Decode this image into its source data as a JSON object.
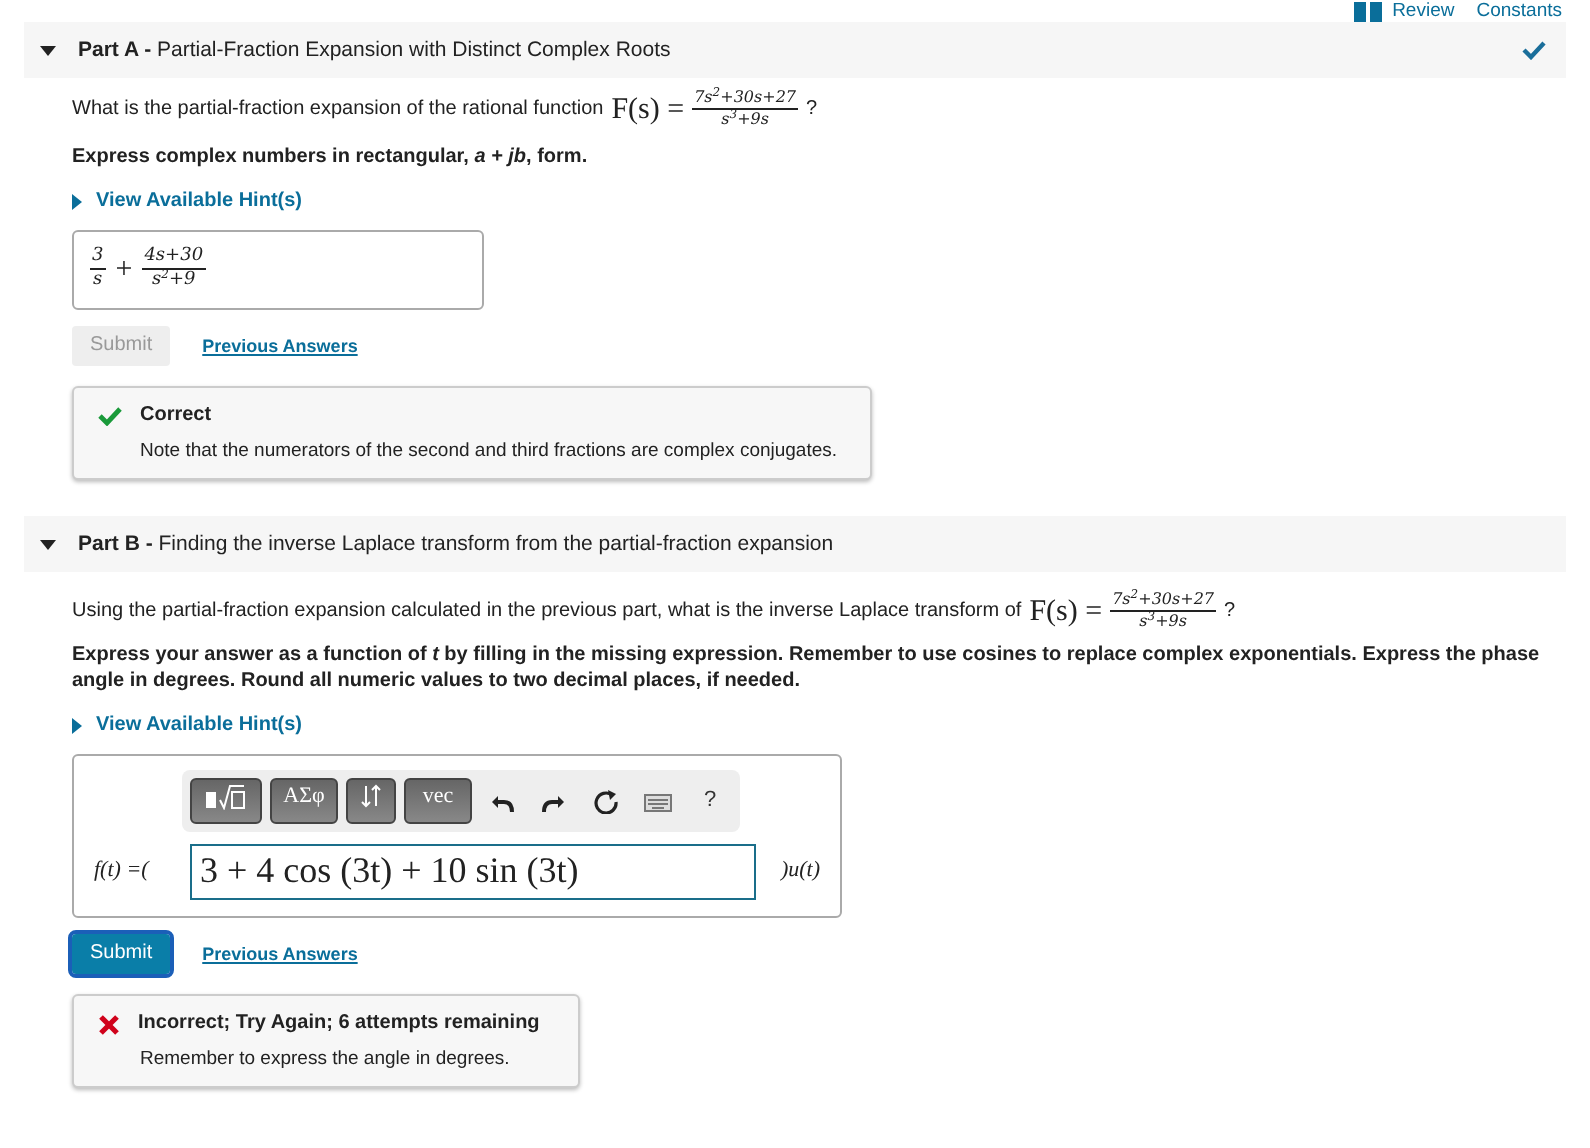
{
  "top_links": [
    {
      "label": "Review"
    },
    {
      "label": "Constants"
    }
  ],
  "parts": [
    {
      "label": "Part A -",
      "title": "Partial-Fraction Expansion with Distinct Complex Roots",
      "expanded": true,
      "completed": true,
      "question": {
        "text": "What is the partial-fraction expansion of the rational function",
        "lhs": "F(s) =",
        "numerator": "7s$^{2}$+30s+27",
        "denominator": "s$^{3}$+9s",
        "suffix": "?"
      },
      "instruction": "Express complex numbers in rectangular, *a + jb*, form.",
      "hint": "View Available Hint(s)",
      "answer": {
        "kind": "fractions",
        "terms": [
          {
            "numerator": "3",
            "denominator": "s"
          },
          {
            "operator": "+",
            "numerator": "4s+30",
            "denominator": "s$^{2}$+9"
          }
        ]
      },
      "submit": {
        "label": "Submit",
        "disabled": true
      },
      "previous": "Previous Answers",
      "feedback": {
        "kind": "correct",
        "title": "Correct",
        "message": "Note that the numerators of the second and third fractions are complex conjugates."
      }
    },
    {
      "label": "Part B -",
      "title": "Finding the inverse Laplace transform from the partial-fraction expansion",
      "expanded": true,
      "completed": false,
      "question": {
        "text": "Using the partial-fraction expansion calculated in the previous part, what is the inverse Laplace transform of",
        "lhs": "F(s) =",
        "numerator": "7s$^{2}$+30s+27",
        "denominator": "s$^{3}$+9s",
        "suffix": "?"
      },
      "instruction": "Express your answer as a function of *t* by filling in the missing expression. Remember to use cosines to replace complex exponentials. Express the phase angle in degrees. Round all numeric values to two decimal places, if needed.",
      "hint": "View Available Hint(s)",
      "answer": {
        "kind": "editor",
        "toolbar": [
          {
            "kind": "templates"
          },
          {
            "kind": "text",
            "label": "ΑΣφ"
          },
          {
            "kind": "arrows"
          },
          {
            "kind": "text",
            "label": "vec"
          },
          {
            "kind": "undo"
          },
          {
            "kind": "redo"
          },
          {
            "kind": "reset"
          },
          {
            "kind": "keyboard"
          },
          {
            "kind": "text",
            "label": "?"
          }
        ],
        "prefix": "f(t) =(",
        "value": "3 + 4 cos (3t) + 10 sin (3t)",
        "suffix": ")u(t)"
      },
      "submit": {
        "label": "Submit",
        "disabled": false
      },
      "previous": "Previous Answers",
      "feedback": {
        "kind": "incorrect",
        "title": "Incorrect; Try Again; 6 attempts remaining",
        "message": "Remember to express the angle in degrees."
      }
    }
  ]
}
